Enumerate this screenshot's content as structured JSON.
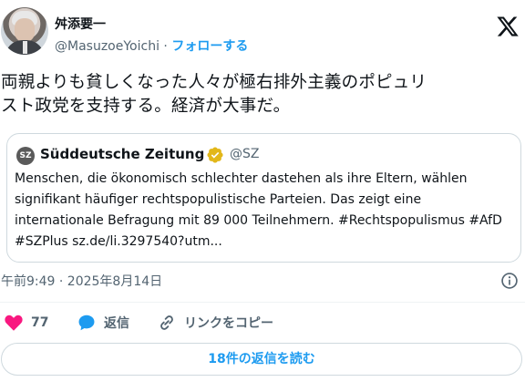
{
  "author": {
    "name": "舛添要一",
    "handle": "@MasuzoeYoichi",
    "separator": "·",
    "follow_label": "フォローする"
  },
  "tweet": {
    "text_line1": "両親よりも貧しくなった人々が極右排外主義のポピュリ",
    "text_line2": "スト政党を支持する。経済が大事だ。"
  },
  "quote": {
    "logo_text": "SZ",
    "name": "Süddeutsche Zeitung",
    "handle": "@SZ",
    "text": "Menschen, die ökonomisch schlechter dastehen als ihre Eltern, wählen signifikant häufiger rechtspopulistische Parteien. Das zeigt eine internationale Befragung mit 89 000 Teilnehmern. #Rechtspopulismus #AfD #SZPlus sz.de/li.3297540?utm..."
  },
  "timestamp": "午前9:49 · 2025年8月14日",
  "actions": {
    "like_count": "77",
    "reply_label": "返信",
    "copy_link_label": "リンクをコピー"
  },
  "more_replies_label": "18件の返信を読む",
  "colors": {
    "accent": "#1d9bf0",
    "like": "#f91880",
    "muted": "#536471",
    "verified": "#e2b719"
  },
  "icons": [
    "x-logo-icon",
    "verified-badge-icon",
    "info-icon",
    "heart-icon",
    "reply-bubble-icon",
    "link-icon"
  ]
}
